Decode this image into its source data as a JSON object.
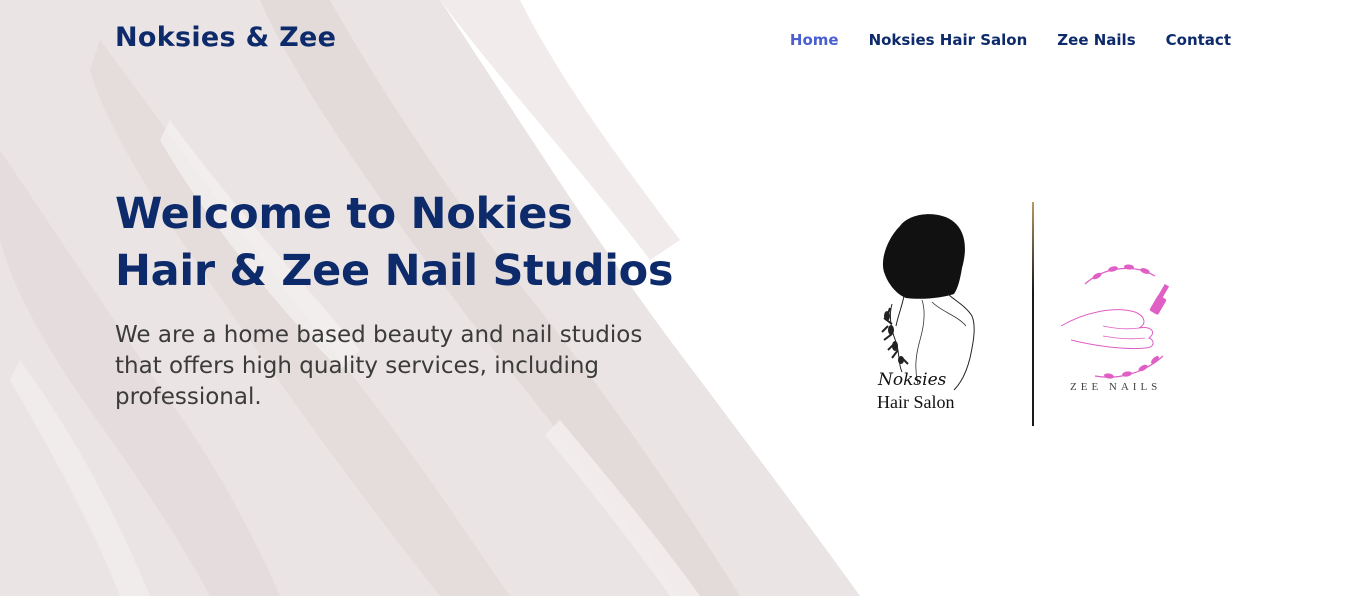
{
  "header": {
    "brand": "Noksies & Zee",
    "nav": [
      {
        "label": "Home",
        "active": true
      },
      {
        "label": "Noksies Hair Salon",
        "active": false
      },
      {
        "label": "Zee Nails",
        "active": false
      },
      {
        "label": "Contact",
        "active": false
      }
    ]
  },
  "hero": {
    "title": "Welcome to Nokies Hair & Zee Nail Studios",
    "description": "We are a home based beauty and nail studios that offers high quality services, including professional."
  },
  "logos": {
    "hair": {
      "script": "Noksies",
      "caption": "Hair Salon",
      "icon": "woman-silhouette-icon"
    },
    "nails": {
      "caption": "ZEE NAILS",
      "icon": "hand-nail-polish-icon"
    }
  },
  "colors": {
    "navy": "#0d2a6b",
    "nav_active": "#4a5fd1",
    "body_text": "#3b3b3b",
    "paint": "#e9e1e1",
    "nails_pink": "#e05fc4"
  }
}
